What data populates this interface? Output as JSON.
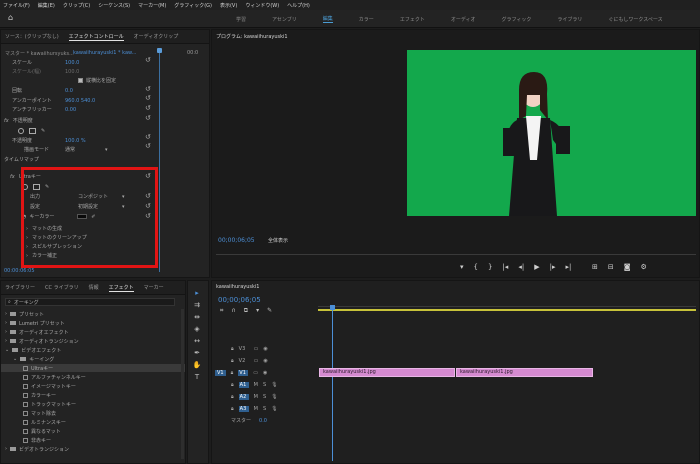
{
  "menu": [
    "ファイル(F)",
    "編集(E)",
    "クリップ(C)",
    "シーケンス(S)",
    "マーカー(M)",
    "グラフィック(G)",
    "表示(V)",
    "ウィンドウ(W)",
    "ヘルプ(H)"
  ],
  "workspaces": [
    "学習",
    "アセンブリ",
    "編集",
    "カラー",
    "エフェクト",
    "オーディオ",
    "グラフィック",
    "ライブラリ",
    "ぐにもしワークスペース"
  ],
  "source_panel": {
    "tabs": [
      "ソース：(クリップなし)",
      "エフェクトコントロール",
      "オーディオクリップ"
    ],
    "subheader_left": "マスター * kawaiihursyuks...",
    "subheader_right": "kawaiihurayuski1 * kaw...",
    "timestamp_top": "00:0",
    "props": [
      {
        "label": "スケール",
        "value": "100.0"
      },
      {
        "label": "スケール(幅)",
        "value": "100.0"
      },
      {
        "label": "縦横比を固定",
        "value": ""
      },
      {
        "label": "回転",
        "value": "0.0"
      },
      {
        "label": "アンカーポイント",
        "value": "960.0   540.0"
      },
      {
        "label": "アンチフリッカー",
        "value": "0.00"
      },
      {
        "label": "不透明度",
        "value": ""
      },
      {
        "label": "不透明度",
        "value": "100.0 %"
      },
      {
        "label": "描画モード",
        "value": "通常"
      },
      {
        "label": "タイムリマップ",
        "value": ""
      }
    ],
    "ultra": {
      "title": "Ultraキー",
      "output_label": "出力",
      "output_value": "コンポジット",
      "setting_label": "設定",
      "setting_value": "初期設定",
      "keycolor_label": "キーカラー",
      "subs": [
        "マットの生成",
        "マットのクリーンアップ",
        "スピルサプレッション",
        "カラー補正"
      ]
    },
    "bottom_time": "00:00:06:05"
  },
  "program": {
    "title": "プログラム: kawaiihurayuski1",
    "timecode": "00;00;06;05",
    "fit": "全体表示",
    "zoom_value": "1/2"
  },
  "effects_panel": {
    "tabs": [
      "ライブラリー",
      "CC ライブラリ",
      "情報",
      "エフェクト",
      "マーカー"
    ],
    "search": "オーキング",
    "tree": [
      {
        "label": "プリセット",
        "level": 0
      },
      {
        "label": "Lumetri プリセット",
        "level": 0
      },
      {
        "label": "オーディオエフェクト",
        "level": 0
      },
      {
        "label": "オーディオトランジション",
        "level": 0
      },
      {
        "label": "ビデオエフェクト",
        "level": 0
      },
      {
        "label": "キーイング",
        "level": 1
      },
      {
        "label": "Ultraキー",
        "level": 2
      },
      {
        "label": "アルファチャンネルキー",
        "level": 2
      },
      {
        "label": "イメージマットキー",
        "level": 2
      },
      {
        "label": "カラーキー",
        "level": 2
      },
      {
        "label": "トラックマットキー",
        "level": 2
      },
      {
        "label": "マット除去",
        "level": 2
      },
      {
        "label": "ルミナンスキー",
        "level": 2
      },
      {
        "label": "異なるマット",
        "level": 2
      },
      {
        "label": "非赤キー",
        "level": 2
      },
      {
        "label": "ビデオトランジション",
        "level": 0
      }
    ]
  },
  "timeline": {
    "tab": "kawaiihurayuski1",
    "timecode": "00;00;06;05",
    "tracks": [
      "V3",
      "V2",
      "V1",
      "A1",
      "A2",
      "A3"
    ],
    "source_label": "V1",
    "master_label": "マスター",
    "master_value": "0.0",
    "clips": [
      "kawaiihurayuski1.jpg",
      "kawaiihurayuski1.jpg"
    ]
  }
}
